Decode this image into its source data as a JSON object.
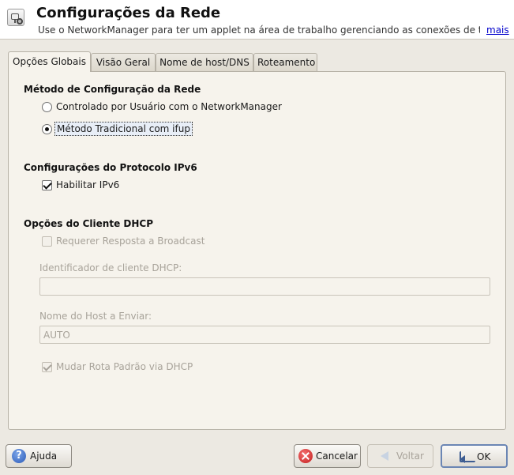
{
  "header": {
    "title": "Configurações da Rede",
    "subtitle": "Use o NetworkManager para ter um applet na área de trabalho gerenciando as conexões de tod…",
    "more_link": "mais",
    "icon": "network-settings-icon"
  },
  "tabs": [
    {
      "label": "Opções Globais",
      "active": true
    },
    {
      "label": "Visão Geral",
      "active": false
    },
    {
      "label": "Nome de host/DNS",
      "active": false
    },
    {
      "label": "Roteamento",
      "active": false
    }
  ],
  "config_method": {
    "title": "Método de Configuração da Rede",
    "options": [
      {
        "label": "Controlado por Usuário com o NetworkManager",
        "selected": false
      },
      {
        "label": "Método Tradicional com ifup",
        "selected": true
      }
    ]
  },
  "ipv6": {
    "title": "Configurações do Protocolo IPv6",
    "enable_label": "Habilitar IPv6",
    "enabled": true
  },
  "dhcp": {
    "title": "Opções do Cliente DHCP",
    "broadcast_label": "Requerer Resposta a Broadcast",
    "broadcast_checked": false,
    "client_id_label": "Identificador de cliente DHCP:",
    "client_id_value": "",
    "hostname_label": "Nome do Host a Enviar:",
    "hostname_value": "AUTO",
    "default_route_label": "Mudar Rota Padrão via DHCP",
    "default_route_checked": true
  },
  "buttons": {
    "help": "Ajuda",
    "cancel": "Cancelar",
    "back": "Voltar",
    "ok": "OK"
  }
}
